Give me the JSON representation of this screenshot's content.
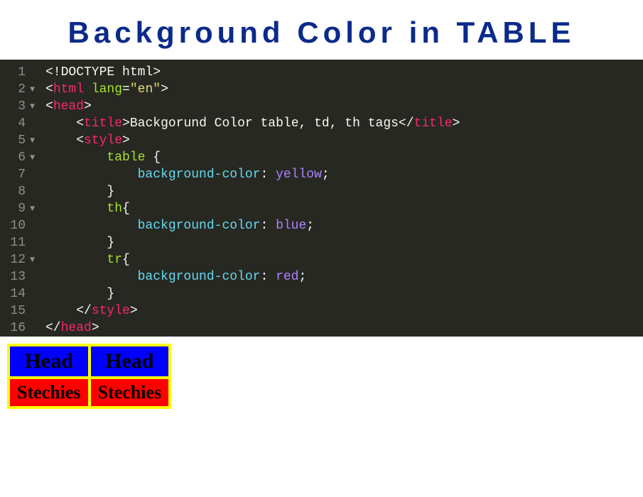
{
  "title": "Background Color in TABLE",
  "code": {
    "lines": [
      {
        "num": "1",
        "fold": "",
        "tokens": [
          [
            "txt",
            "<!DOCTYPE html>"
          ]
        ]
      },
      {
        "num": "2",
        "fold": "▼",
        "tokens": [
          [
            "punc",
            "<"
          ],
          [
            "tag",
            "html "
          ],
          [
            "attr",
            "lang"
          ],
          [
            "punc",
            "="
          ],
          [
            "str",
            "\"en\""
          ],
          [
            "punc",
            ">"
          ]
        ]
      },
      {
        "num": "3",
        "fold": "▼",
        "tokens": [
          [
            "punc",
            "<"
          ],
          [
            "tag",
            "head"
          ],
          [
            "punc",
            ">"
          ]
        ]
      },
      {
        "num": "4",
        "fold": "",
        "tokens": [
          [
            "txt",
            "    "
          ],
          [
            "punc",
            "<"
          ],
          [
            "tag",
            "title"
          ],
          [
            "punc",
            ">"
          ],
          [
            "txt",
            "Backgorund Color table, td, th tags"
          ],
          [
            "punc",
            "</"
          ],
          [
            "tag",
            "title"
          ],
          [
            "punc",
            ">"
          ]
        ]
      },
      {
        "num": "5",
        "fold": "▼",
        "tokens": [
          [
            "txt",
            "    "
          ],
          [
            "punc",
            "<"
          ],
          [
            "tag",
            "style"
          ],
          [
            "punc",
            ">"
          ]
        ]
      },
      {
        "num": "6",
        "fold": "▼",
        "tokens": [
          [
            "txt",
            "        "
          ],
          [
            "sel",
            "table"
          ],
          [
            "txt",
            " "
          ],
          [
            "brace",
            "{"
          ]
        ]
      },
      {
        "num": "7",
        "fold": "",
        "tokens": [
          [
            "txt",
            "            "
          ],
          [
            "prop",
            "background-color"
          ],
          [
            "punc",
            ": "
          ],
          [
            "val",
            "yellow"
          ],
          [
            "punc",
            ";"
          ]
        ]
      },
      {
        "num": "8",
        "fold": "",
        "tokens": [
          [
            "txt",
            "        "
          ],
          [
            "brace",
            "}"
          ]
        ]
      },
      {
        "num": "9",
        "fold": "▼",
        "tokens": [
          [
            "txt",
            "        "
          ],
          [
            "sel",
            "th"
          ],
          [
            "brace",
            "{"
          ]
        ]
      },
      {
        "num": "10",
        "fold": "",
        "tokens": [
          [
            "txt",
            "            "
          ],
          [
            "prop",
            "background-color"
          ],
          [
            "punc",
            ": "
          ],
          [
            "val",
            "blue"
          ],
          [
            "punc",
            ";"
          ]
        ]
      },
      {
        "num": "11",
        "fold": "",
        "tokens": [
          [
            "txt",
            "        "
          ],
          [
            "brace",
            "}"
          ]
        ]
      },
      {
        "num": "12",
        "fold": "▼",
        "tokens": [
          [
            "txt",
            "        "
          ],
          [
            "sel",
            "tr"
          ],
          [
            "brace",
            "{"
          ]
        ]
      },
      {
        "num": "13",
        "fold": "",
        "tokens": [
          [
            "txt",
            "            "
          ],
          [
            "prop",
            "background-color"
          ],
          [
            "punc",
            ": "
          ],
          [
            "val",
            "red"
          ],
          [
            "punc",
            ";"
          ]
        ]
      },
      {
        "num": "14",
        "fold": "",
        "tokens": [
          [
            "txt",
            "        "
          ],
          [
            "brace",
            "}"
          ]
        ]
      },
      {
        "num": "15",
        "fold": "",
        "tokens": [
          [
            "txt",
            "    "
          ],
          [
            "punc",
            "</"
          ],
          [
            "tag",
            "style"
          ],
          [
            "punc",
            ">"
          ]
        ]
      },
      {
        "num": "16",
        "fold": "",
        "tokens": [
          [
            "punc",
            "</"
          ],
          [
            "tag",
            "head"
          ],
          [
            "punc",
            ">"
          ]
        ]
      }
    ]
  },
  "demo": {
    "headers": [
      "Head",
      "Head"
    ],
    "cells": [
      "Stechies",
      "Stechies"
    ]
  },
  "colors": {
    "title": "#0b2b8a",
    "editor_bg": "#272822",
    "table_bg": "yellow",
    "th_bg": "blue",
    "tr_bg": "red"
  }
}
